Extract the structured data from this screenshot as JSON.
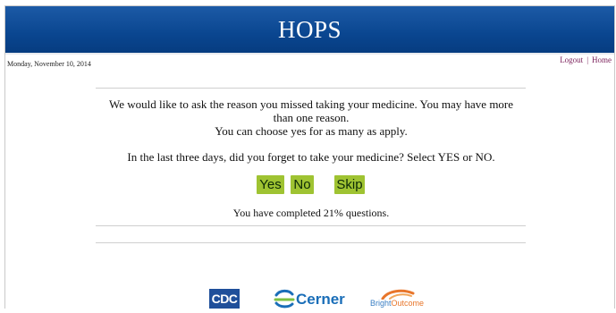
{
  "header": {
    "title": "HOPS"
  },
  "date": "Monday, November 10, 2014",
  "nav": {
    "logout": "Logout",
    "separator": "|",
    "home": "Home"
  },
  "question": {
    "intro_line1": "We would like to ask the reason you missed taking your medicine. You may have more",
    "intro_line2": "than one reason.",
    "intro_line3": "You can choose yes for as many as apply.",
    "prompt": "In the last three days, did you forget to take your medicine? Select YES or NO."
  },
  "buttons": {
    "yes": "Yes",
    "no": "No",
    "skip": "Skip"
  },
  "progress": {
    "text": "You have completed 21% questions.",
    "percent": 21
  },
  "logos": {
    "cdc": "CDC",
    "cerner": "Cerner",
    "brightoutcome_part1": "Bright",
    "brightoutcome_part2": "Outcome"
  },
  "colors": {
    "header": "#0a4690",
    "button": "#9fc332",
    "link": "#7a1f5a"
  }
}
